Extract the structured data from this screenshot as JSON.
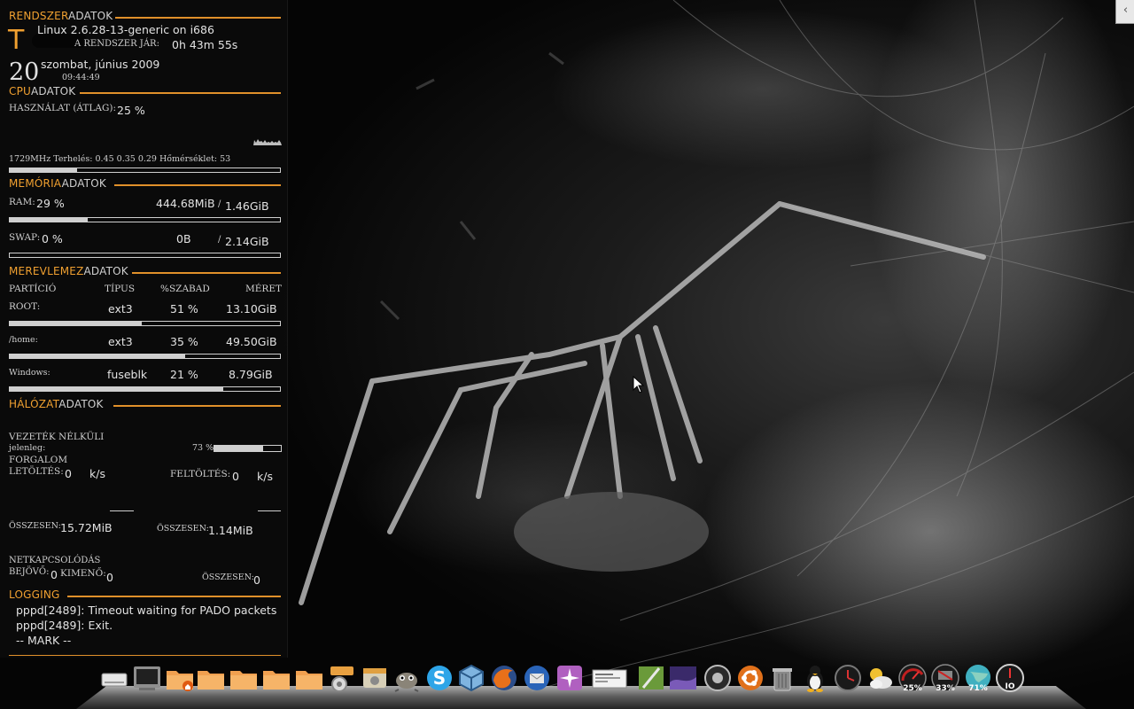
{
  "system": {
    "header_accent": "RENDSZER",
    "header_rest": "ADATOK",
    "logo_letter": "T",
    "kernel": "Linux  2.6.28-13-generic on i686",
    "uptime_label": "A RENDSZER JÁR:",
    "uptime": "0h 43m 55s",
    "day": "20",
    "date": "szombat, június 2009",
    "time": "09:44:49"
  },
  "cpu": {
    "header_accent": "CPU",
    "header_rest": "ADATOK",
    "usage_label": "HASZNÁLAT (ÁTLAG):",
    "usage": "25 %",
    "usage_pct": 25,
    "info": "1729MHz Terhelés: 0.45 0.35 0.29 Hőmérséklet: 53"
  },
  "memory": {
    "header_accent": "MEMÓRIA",
    "header_rest": "ADATOK",
    "ram_label": "RAM:",
    "ram_pct": "29 %",
    "ram_pct_value": 29,
    "ram_used": "444.68MiB",
    "ram_sep": "/",
    "ram_total": "1.46GiB",
    "swap_label": "SWAP:",
    "swap_pct": "0  %",
    "swap_pct_value": 0,
    "swap_used": "0B",
    "swap_sep": "/",
    "swap_total": "2.14GiB"
  },
  "disk": {
    "header_accent": "MEREVLEMEZ",
    "header_rest": "ADATOK",
    "columns": [
      "PARTÍCIÓ",
      "TÍPUS",
      "%SZABAD",
      "MÉRET"
    ],
    "rows": [
      {
        "name": "ROOT:",
        "type": "ext3",
        "free": "51 %",
        "size": "13.10GiB",
        "free_value": 51
      },
      {
        "name": "/home:",
        "type": "ext3",
        "free": "35 %",
        "size": "49.50GiB",
        "free_value": 35
      },
      {
        "name": "Windows:",
        "type": "fuseblk",
        "free": "21 %",
        "size": "8.79GiB",
        "free_value": 21
      }
    ]
  },
  "network": {
    "header_accent": "HÁLÓZAT",
    "header_rest": "ADATOK",
    "wireless_label": "VEZETÉK NÉLKÜLI",
    "current_label": "jelenleg:",
    "signal_pct": "73 %",
    "signal_value": 73,
    "traffic_label": "FORGALOM",
    "down_label": "LETÖLTÉS:",
    "down_value": "0",
    "down_unit": "k/s",
    "up_label": "FELTÖLTÉS:",
    "up_value": "0",
    "up_unit": "k/s",
    "total_label": "ÖSSZESEN:",
    "total_down": "15.72MiB",
    "total_up": "1.14MiB",
    "conn_label": "NETKAPCSOLÓDÁS",
    "in_label": "BEJÖVŐ:",
    "in_value": "0",
    "out_label": "KIMENŐ:",
    "out_value": "0",
    "conn_total_label": "ÖSSZESEN:",
    "conn_total_value": "0"
  },
  "logging": {
    "header_accent": "LOGGING",
    "lines": [
      "pppd[2489]: Timeout waiting for PADO packets",
      "pppd[2489]: Exit.",
      "-- MARK --"
    ]
  },
  "handle": {
    "glyph": "‹"
  },
  "dock": {
    "items": [
      "drive-icon",
      "terminal-icon",
      "home-folder-icon",
      "folder-icon",
      "folder-icon",
      "folder-icon",
      "folder-icon",
      "settings-icon",
      "archive-icon",
      "recycle-icon",
      "gimp-icon",
      "skype-icon",
      "virtualbox-icon",
      "firefox-icon",
      "thunderbird-icon",
      "star-app-icon",
      "window-preview-icon",
      "text-editor-icon",
      "wallpaper-icon",
      "orb-icon",
      "ubuntu-icon",
      "trash-icon",
      "tux-icon",
      "clock-icon",
      "weather-icon",
      "cpu-gauge-icon",
      "ram-gauge-icon",
      "globe-gauge-icon",
      "io-gauge-icon"
    ],
    "cpu_gauge_text": "25%",
    "ram_gauge_text": "33%",
    "globe_gauge_text": "71%",
    "io_gauge_text": "IO"
  },
  "colors": {
    "accent": "#f0a030",
    "text": "#d6d6d6"
  }
}
